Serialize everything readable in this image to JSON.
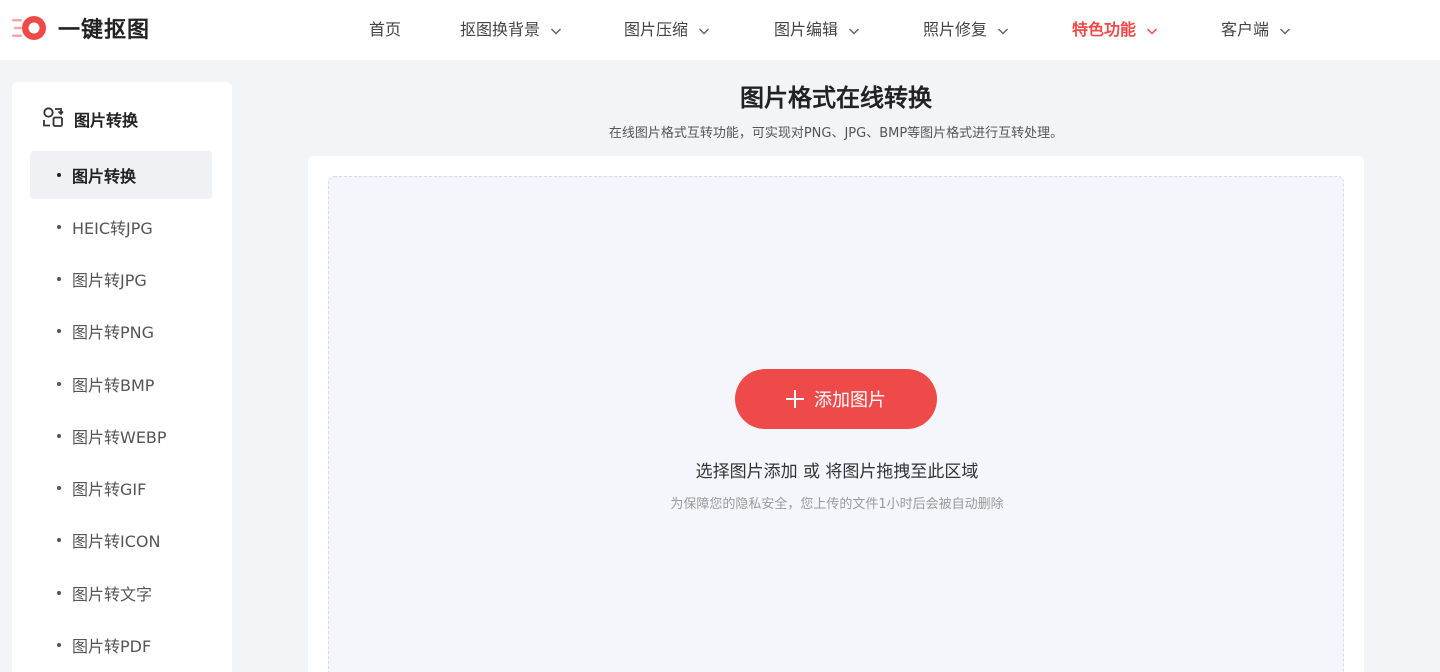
{
  "brand": {
    "title": "一键抠图",
    "accent": "#ef4a4a"
  },
  "nav": [
    {
      "label": "首页",
      "has_dropdown": false,
      "active": false
    },
    {
      "label": "抠图换背景",
      "has_dropdown": true,
      "active": false
    },
    {
      "label": "图片压缩",
      "has_dropdown": true,
      "active": false
    },
    {
      "label": "图片编辑",
      "has_dropdown": true,
      "active": false
    },
    {
      "label": "照片修复",
      "has_dropdown": true,
      "active": false
    },
    {
      "label": "特色功能",
      "has_dropdown": true,
      "active": true
    },
    {
      "label": "客户端",
      "has_dropdown": true,
      "active": false
    }
  ],
  "sidebar": {
    "heading": "图片转换",
    "heading_icon": "convert-icon",
    "items": [
      {
        "label": "图片转换",
        "active": true
      },
      {
        "label": "HEIC转JPG",
        "active": false
      },
      {
        "label": "图片转JPG",
        "active": false
      },
      {
        "label": "图片转PNG",
        "active": false
      },
      {
        "label": "图片转BMP",
        "active": false
      },
      {
        "label": "图片转WEBP",
        "active": false
      },
      {
        "label": "图片转GIF",
        "active": false
      },
      {
        "label": "图片转ICON",
        "active": false
      },
      {
        "label": "图片转文字",
        "active": false
      },
      {
        "label": "图片转PDF",
        "active": false
      }
    ]
  },
  "main": {
    "title": "图片格式在线转换",
    "subtitle": "在线图片格式互转功能，可实现对PNG、JPG、BMP等图片格式进行互转处理。",
    "upload": {
      "button_label": "添加图片",
      "button_icon": "plus-icon",
      "hint": "选择图片添加 或 将图片拖拽至此区域",
      "note": "为保障您的隐私安全，您上传的文件1小时后会被自动删除"
    }
  }
}
